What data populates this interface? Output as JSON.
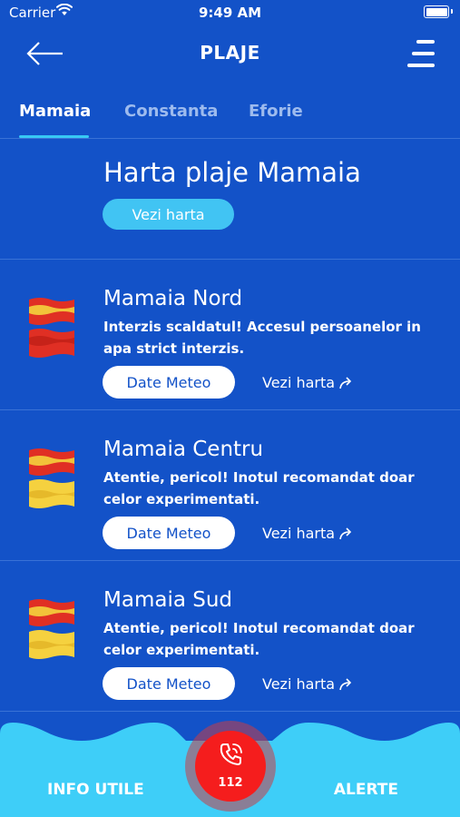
{
  "status_bar": {
    "carrier": "Carrier",
    "time": "9:49 AM"
  },
  "nav": {
    "title": "PLAJE"
  },
  "tabs": [
    {
      "label": "Mamaia",
      "active": true
    },
    {
      "label": "Constanta",
      "active": false
    },
    {
      "label": "Eforie",
      "active": false
    }
  ],
  "map_section": {
    "title": "Harta plaje Mamaia",
    "button_label": "Vezi harta"
  },
  "beaches": [
    {
      "name": "Mamaia Nord",
      "warning": "Interzis scaldatul! Accesul persoanelor in apa strict interzis.",
      "flags": [
        "red-flag",
        "red-flag"
      ],
      "meteo_label": "Date Meteo",
      "map_label": "Vezi harta"
    },
    {
      "name": "Mamaia Centru",
      "warning": "Atentie, pericol! Inotul recomandat doar celor experimentati.",
      "flags": [
        "red-flag",
        "yellow-flag"
      ],
      "meteo_label": "Date Meteo",
      "map_label": "Vezi harta"
    },
    {
      "name": "Mamaia Sud",
      "warning": "Atentie, pericol! Inotul recomandat doar celor experimentati.",
      "flags": [
        "red-flag",
        "yellow-flag"
      ],
      "meteo_label": "Date Meteo",
      "map_label": "Vezi harta"
    }
  ],
  "bottom": {
    "info_label": "INFO UTILE",
    "sos_number": "112",
    "alert_label": "ALERTE"
  },
  "colors": {
    "background": "#1352c8",
    "accent": "#37c9f4",
    "pill": "#41c4f3",
    "bottom_bar": "#3ecef8",
    "sos": "#f51d1d"
  }
}
